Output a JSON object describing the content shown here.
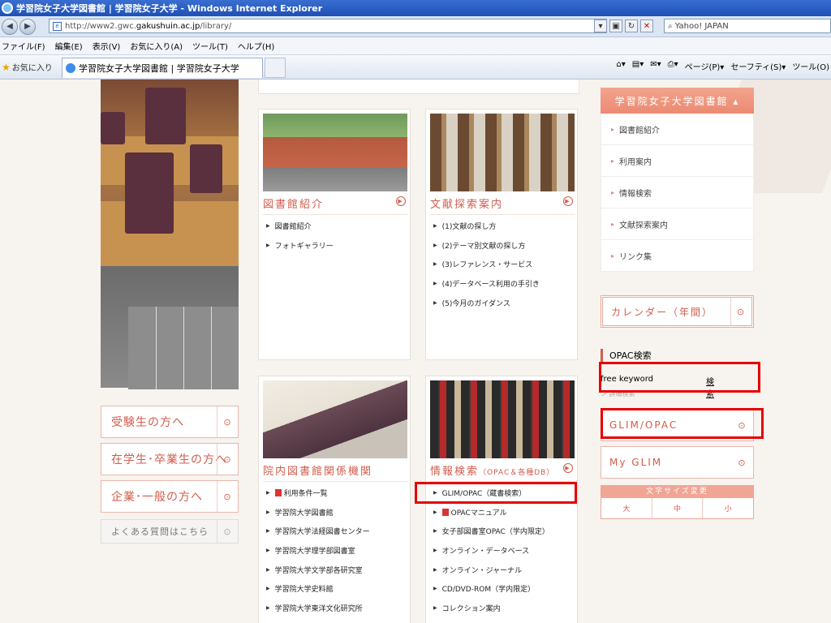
{
  "browser": {
    "title": "学習院女子大学図書館 | 学習院女子大学 - Windows Internet Explorer",
    "url_prefix": "http://www2.gwc.",
    "url_host": "gakushuin.ac.jp",
    "url_path": "/library/",
    "search_placeholder": "Yahoo! JAPAN",
    "menu": [
      "ファイル(F)",
      "編集(E)",
      "表示(V)",
      "お気に入り(A)",
      "ツール(T)",
      "ヘルプ(H)"
    ],
    "favorites_label": "お気に入り",
    "tab_title": "学習院女子大学図書館 | 学習院女子大学",
    "commands": [
      "ページ(P)▾",
      "セーフティ(S)▾",
      "ツール(O)"
    ]
  },
  "left": {
    "buttons": [
      "受験生の方へ",
      "在学生･卒業生の方へ",
      "企業･一般の方へ"
    ],
    "faq": "よくある質問はこちら"
  },
  "panels": {
    "intro": {
      "title": "図書館紹介",
      "items": [
        "図書館紹介",
        "フォトギャラリー"
      ]
    },
    "guide": {
      "title": "文献探索案内",
      "items": [
        "(1)文献の探し方",
        "(2)テーマ別文献の探し方",
        "(3)レファレンス・サービス",
        "(4)データベース利用の手引き",
        "(5)今月のガイダンス"
      ]
    },
    "related": {
      "title": "院内図書館関係機関",
      "items": [
        "利用条件一覧",
        "学習院大学図書館",
        "学習院大学法経図書センター",
        "学習院大学理学部図書室",
        "学習院大学文学部各研究室",
        "学習院大学史料館",
        "学習院大学東洋文化研究所"
      ]
    },
    "search": {
      "title": "情報検索",
      "subtitle": "（OPAC＆各種DB）",
      "items": [
        "GLIM/OPAC（蔵書検索）",
        "OPACマニュアル",
        "女子部図書室OPAC（学内限定）",
        "オンライン・データベース",
        "オンライン・ジャーナル",
        "CD/DVD-ROM（学内限定）",
        "コレクション案内"
      ]
    }
  },
  "rightnav": {
    "head": "学習院女子大学図書館 ▴",
    "items": [
      "図書館紹介",
      "利用案内",
      "情報検索",
      "文献探索案内",
      "リンク集"
    ],
    "calendar": "カレンダー（年間）",
    "opac_title": "OPAC検索",
    "opac_input": "free keyword",
    "opac_button": "検索",
    "opac_detail": "ン 詳細検索",
    "glim_opac": "GLIM/OPAC",
    "my_glim": "My GLIM",
    "font_caption": "文字サイズ変更",
    "font_sizes": [
      "大",
      "中",
      "小"
    ]
  },
  "colors": {
    "accent": "#d25c4c",
    "highlight": "#e60000"
  }
}
